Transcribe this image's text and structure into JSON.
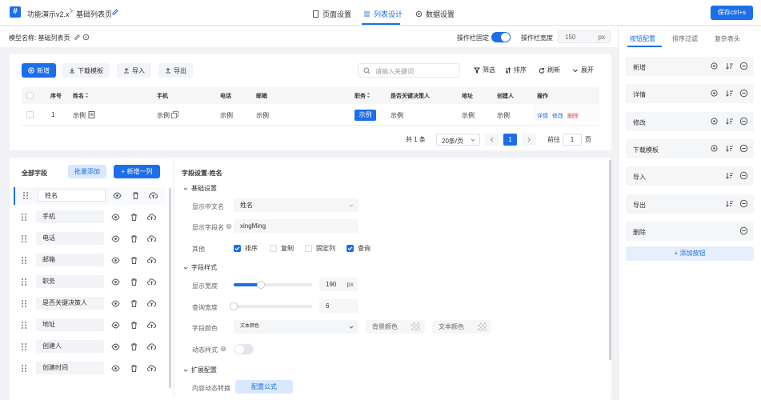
{
  "topbar": {
    "app_title": "功能演示v2.x",
    "page_title": "基础列表页",
    "tabs": [
      {
        "label": "页面设置"
      },
      {
        "label": "列表设计"
      },
      {
        "label": "数据设置"
      }
    ],
    "save_button": "保存ctrl+s"
  },
  "subbar": {
    "model_label": "模型名称: 基础列表页",
    "fixed_ops_label": "操作栏固定",
    "ops_width_label": "操作栏宽度",
    "ops_width_value": "150",
    "ops_width_unit": "px"
  },
  "preview": {
    "toolbar": {
      "add": "新增",
      "download": "下载模板",
      "import": "导入",
      "export": "导出",
      "search_placeholder": "请输入关键词",
      "filter": "筛选",
      "sort": "排序",
      "refresh": "刷新",
      "expand": "展开"
    },
    "table": {
      "headers": [
        "序号",
        "姓名",
        "手机",
        "电话",
        "邮箱",
        "职务",
        "是否关键决策人",
        "地址",
        "创建人",
        "操作"
      ],
      "row": {
        "index": "1",
        "name": "示例",
        "mobile": "示例",
        "phone": "示例",
        "email": "示例",
        "position": "示例",
        "decision": "示例",
        "address": "示例",
        "creator": "示例",
        "actions": [
          "详情",
          "修改",
          "删除"
        ]
      }
    },
    "pagination": {
      "total": "共 1 条",
      "page_size": "20条/页",
      "current": "1",
      "goto_label": "前往",
      "goto_value": "1",
      "page_unit": "页"
    }
  },
  "fields": {
    "title": "全部字段",
    "bulk_add": "批量添加",
    "add_column": "新增一列",
    "items": [
      "姓名",
      "手机",
      "电话",
      "邮箱",
      "职务",
      "是否关键决策人",
      "地址",
      "创建人",
      "创建时间"
    ]
  },
  "settings": {
    "title": "字段设置-姓名",
    "basic_section": "基础设置",
    "display_name_label": "显示中文名",
    "display_name_value": "姓名",
    "field_name_label": "显示字段名",
    "field_name_value": "xingMing",
    "other_label": "其他",
    "options": [
      {
        "label": "排序",
        "checked": true
      },
      {
        "label": "复制",
        "checked": false
      },
      {
        "label": "固定列",
        "checked": false
      },
      {
        "label": "查询",
        "checked": true
      }
    ],
    "style_section": "字段样式",
    "display_width_label": "显示宽度",
    "display_width_value": "190",
    "display_width_unit": "px",
    "display_width_fraction": 0.35,
    "query_width_label": "查询宽度",
    "query_width_value": "6",
    "query_width_fraction": 0.0,
    "font_color_label": "字段颜色",
    "font_color_value": "文本颜色",
    "bg_color_label": "背景颜色",
    "text_color_label": "文本颜色",
    "dynamic_style_label": "动态样式",
    "ext_section": "扩展配置",
    "content_transform_label": "内容动态转换",
    "formula_button": "配置公式"
  },
  "rightpanel": {
    "tabs": [
      "按钮配置",
      "排序过滤",
      "复杂表头"
    ],
    "buttons": [
      "新增",
      "详情",
      "修改",
      "下载模板",
      "导入",
      "导出",
      "删除"
    ],
    "add_button": "添加按钮"
  },
  "colors": {
    "accent": "#1c6fe8",
    "danger": "#e5484d"
  }
}
